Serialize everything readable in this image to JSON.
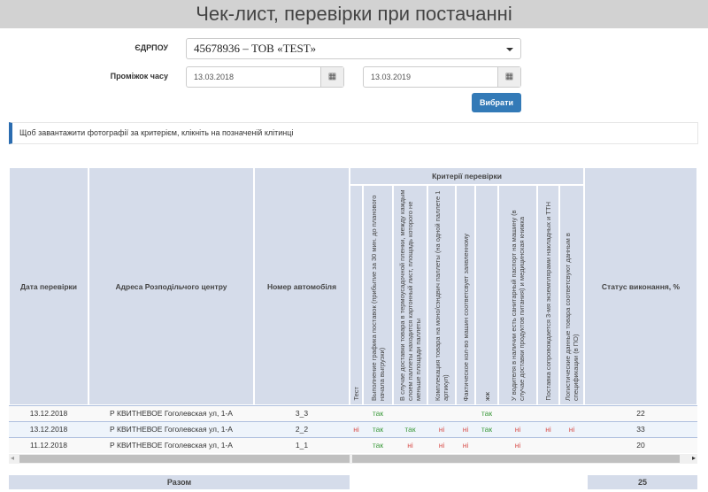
{
  "title": "Чек-лист, перевірки при постачанні",
  "form": {
    "edrpou_label": "ЄДРПОУ",
    "edrpou_value": "45678936 – ТОВ «TEST»",
    "period_label": "Проміжок часу",
    "date_from": "13.03.2018",
    "date_to": "13.03.2019",
    "select_button": "Вибрати"
  },
  "info": "Щоб завантажити фотографії за критерієм, клікніть на позначеній клітинці",
  "table": {
    "headers": {
      "date": "Дата перевірки",
      "address": "Адреса Розподільчого центру",
      "car": "Номер автомобіля",
      "criteria": "Критерії перевірки",
      "status": "Статус виконання, %"
    },
    "criteria": [
      "Тест",
      "Выполнение графика поставок (прибытие за 30 мин. до планового начала выгрузки)",
      "В случае доставки товара в термоусадочной пленки, между каждым слоем паллеты находится картонный лист, площадь которого не меньше площади паллеты",
      "Комплекация товара на моно/сэндвич паллеты (на одной паллете 1 артикул)",
      "Фактическое кол-во машин соответсвует заявленному",
      "жж",
      "У водителя в наличии есть санитарный паспорт на машину (в случае доставки продуктов питания) и медицинская книжка",
      "Поставка сопровождается 3-мя экземплярами накладных и ТТН",
      "Логистические данные товара соответсвуют данным в спецификации (в ПО)"
    ],
    "rows": [
      {
        "date": "13.12.2018",
        "address": "Р КВИТНЕВОЕ Гоголевская ул, 1-А",
        "car": "3_3",
        "marks": [
          "",
          "так",
          "",
          "",
          "",
          "так",
          "",
          "",
          ""
        ],
        "status": "22"
      },
      {
        "date": "13.12.2018",
        "address": "Р КВИТНЕВОЕ Гоголевская ул, 1-А",
        "car": "2_2",
        "marks": [
          "ні",
          "так",
          "так",
          "ні",
          "ні",
          "так",
          "ні",
          "ні",
          "ні"
        ],
        "status": "33"
      },
      {
        "date": "11.12.2018",
        "address": "Р КВИТНЕВОЕ Гоголевская ул, 1-А",
        "car": "1_1",
        "marks": [
          "",
          "так",
          "ні",
          "ні",
          "ні",
          "",
          "ні",
          "",
          ""
        ],
        "status": "20"
      }
    ],
    "total_label": "Разом",
    "total_value": "25"
  }
}
